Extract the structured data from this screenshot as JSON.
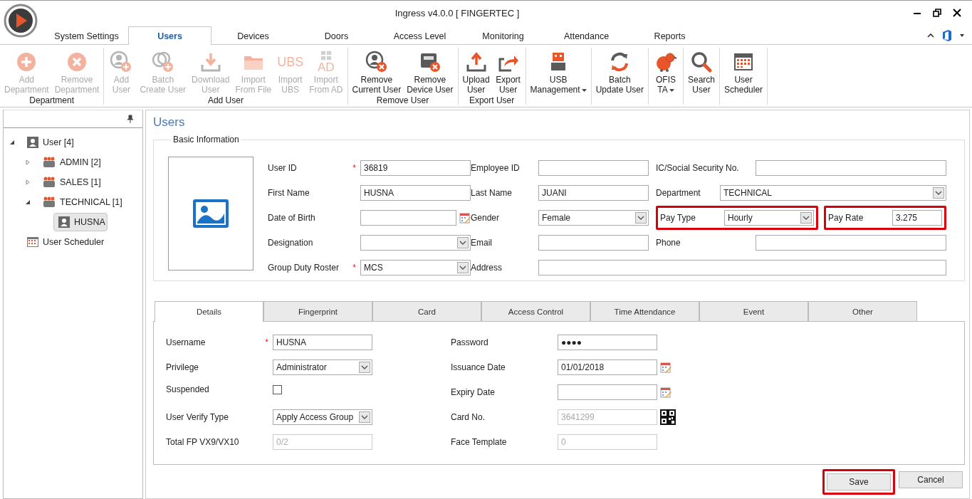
{
  "window": {
    "title": "Ingress v4.0.0 [ FINGERTEC ]"
  },
  "menu_tabs": [
    {
      "label": "System Settings",
      "selected": false
    },
    {
      "label": "Users",
      "selected": true
    },
    {
      "label": "Devices",
      "selected": false
    },
    {
      "label": "Doors",
      "selected": false
    },
    {
      "label": "Access Level",
      "selected": false
    },
    {
      "label": "Monitoring",
      "selected": false
    },
    {
      "label": "Attendance",
      "selected": false
    },
    {
      "label": "Reports",
      "selected": false
    }
  ],
  "ribbon": {
    "groups": [
      {
        "label": "Department",
        "items": [
          {
            "label": "Add\nDepartment",
            "disabled": true
          },
          {
            "label": "Remove\nDepartment",
            "disabled": true
          }
        ]
      },
      {
        "label": "Add User",
        "items": [
          {
            "label": "Add\nUser",
            "disabled": true
          },
          {
            "label": "Batch\nCreate User",
            "disabled": true
          },
          {
            "label": "Download\nUser",
            "disabled": true
          },
          {
            "label": "Import\nFrom File",
            "disabled": true
          },
          {
            "label": "Import\nUBS",
            "disabled": true,
            "icon_text": "UBS"
          },
          {
            "label": "Import\nFrom AD",
            "disabled": true,
            "icon_text": "AD"
          }
        ]
      },
      {
        "label": "Remove User",
        "items": [
          {
            "label": "Remove\nCurrent User",
            "disabled": false
          },
          {
            "label": "Remove\nDevice User",
            "disabled": false
          }
        ]
      },
      {
        "label": "Export User",
        "items": [
          {
            "label": "Upload\nUser",
            "disabled": false
          },
          {
            "label": "Export\nUser",
            "disabled": false
          }
        ]
      },
      {
        "items": [
          {
            "label": "USB\nManagement",
            "disabled": false,
            "dropdown": true
          }
        ]
      },
      {
        "items": [
          {
            "label": "Batch\nUpdate User",
            "disabled": false
          }
        ]
      },
      {
        "items": [
          {
            "label": "OFIS\nTA",
            "disabled": false,
            "dropdown": true
          }
        ]
      },
      {
        "items": [
          {
            "label": "Search\nUser",
            "disabled": false
          }
        ]
      },
      {
        "items": [
          {
            "label": "User\nScheduler",
            "disabled": false
          }
        ]
      }
    ]
  },
  "sidebar": {
    "tree": [
      {
        "label": "User [4]",
        "kind": "user",
        "expanded": true,
        "selected": false,
        "children": [
          {
            "label": "ADMIN [2]",
            "kind": "group",
            "expanded": false,
            "selected": false
          },
          {
            "label": "SALES [1]",
            "kind": "group",
            "expanded": false,
            "selected": false
          },
          {
            "label": "TECHNICAL [1]",
            "kind": "group",
            "expanded": true,
            "selected": false,
            "children": [
              {
                "label": "HUSNA",
                "kind": "user",
                "selected": true
              }
            ]
          }
        ]
      },
      {
        "label": "User Scheduler",
        "kind": "scheduler",
        "selected": false
      }
    ]
  },
  "content": {
    "title": "Users",
    "basic_information": {
      "legend": "Basic Information",
      "rows": [
        [
          {
            "label": "User ID",
            "kind": "text",
            "marker": "*",
            "value": "36819"
          },
          {
            "label": "Employee ID",
            "kind": "text"
          },
          {
            "label": "IC/Social Security No.",
            "kind": "text"
          }
        ],
        [
          {
            "label": "First Name",
            "kind": "text",
            "value": "HUSNA"
          },
          {
            "label": "Last Name",
            "kind": "text",
            "value": "JUANI"
          },
          {
            "label": "Department",
            "kind": "select",
            "value": "TECHNICAL"
          }
        ],
        [
          {
            "label": "Date of Birth",
            "kind": "date"
          },
          {
            "label": "Gender",
            "kind": "select",
            "value": "Female"
          },
          {
            "label": "Pay Type",
            "kind": "select",
            "value": "Hourly",
            "highlighted": true
          },
          {
            "label": "Pay Rate",
            "kind": "text",
            "value": "3.275",
            "highlighted": true
          }
        ],
        [
          {
            "label": "Designation",
            "kind": "select"
          },
          {
            "label": "Email",
            "kind": "text"
          },
          {
            "label": "Phone",
            "kind": "text"
          }
        ],
        [
          {
            "label": "Group Duty Roster",
            "kind": "select",
            "marker": "*",
            "value": "MCS"
          },
          {
            "label": "Address",
            "kind": "text"
          }
        ]
      ]
    },
    "tabs": [
      {
        "label": "Details",
        "selected": true
      },
      {
        "label": "Fingerprint",
        "selected": false
      },
      {
        "label": "Card",
        "selected": false
      },
      {
        "label": "Access Control",
        "selected": false
      },
      {
        "label": "Time Attendance",
        "selected": false
      },
      {
        "label": "Event",
        "selected": false
      },
      {
        "label": "Other",
        "selected": false
      }
    ],
    "details": [
      [
        {
          "label": "Username",
          "kind": "text",
          "marker": "*",
          "value": "HUSNA"
        },
        {
          "label": "Password",
          "kind": "password",
          "value": "●●●●"
        }
      ],
      [
        {
          "label": "Privilege",
          "kind": "select",
          "value": "Administrator"
        },
        {
          "label": "Issuance Date",
          "kind": "date",
          "value": "01/01/2018"
        }
      ],
      [
        {
          "label": "Suspended",
          "kind": "checkbox",
          "checked": false
        },
        {
          "label": "Expiry Date",
          "kind": "date"
        }
      ],
      [
        {
          "label": "User Verify Type",
          "kind": "select",
          "value": "Apply Access Group"
        },
        {
          "label": "Card No.",
          "kind": "card",
          "value": "3641299",
          "disabled": true
        }
      ],
      [
        {
          "label": "Total FP VX9/VX10",
          "kind": "text",
          "value": "0/2",
          "disabled": true
        },
        {
          "label": "Face Template",
          "kind": "text",
          "value": "0",
          "disabled": true
        }
      ]
    ],
    "buttons": [
      {
        "label": "Save",
        "highlighted": true
      },
      {
        "label": "Cancel"
      }
    ]
  }
}
